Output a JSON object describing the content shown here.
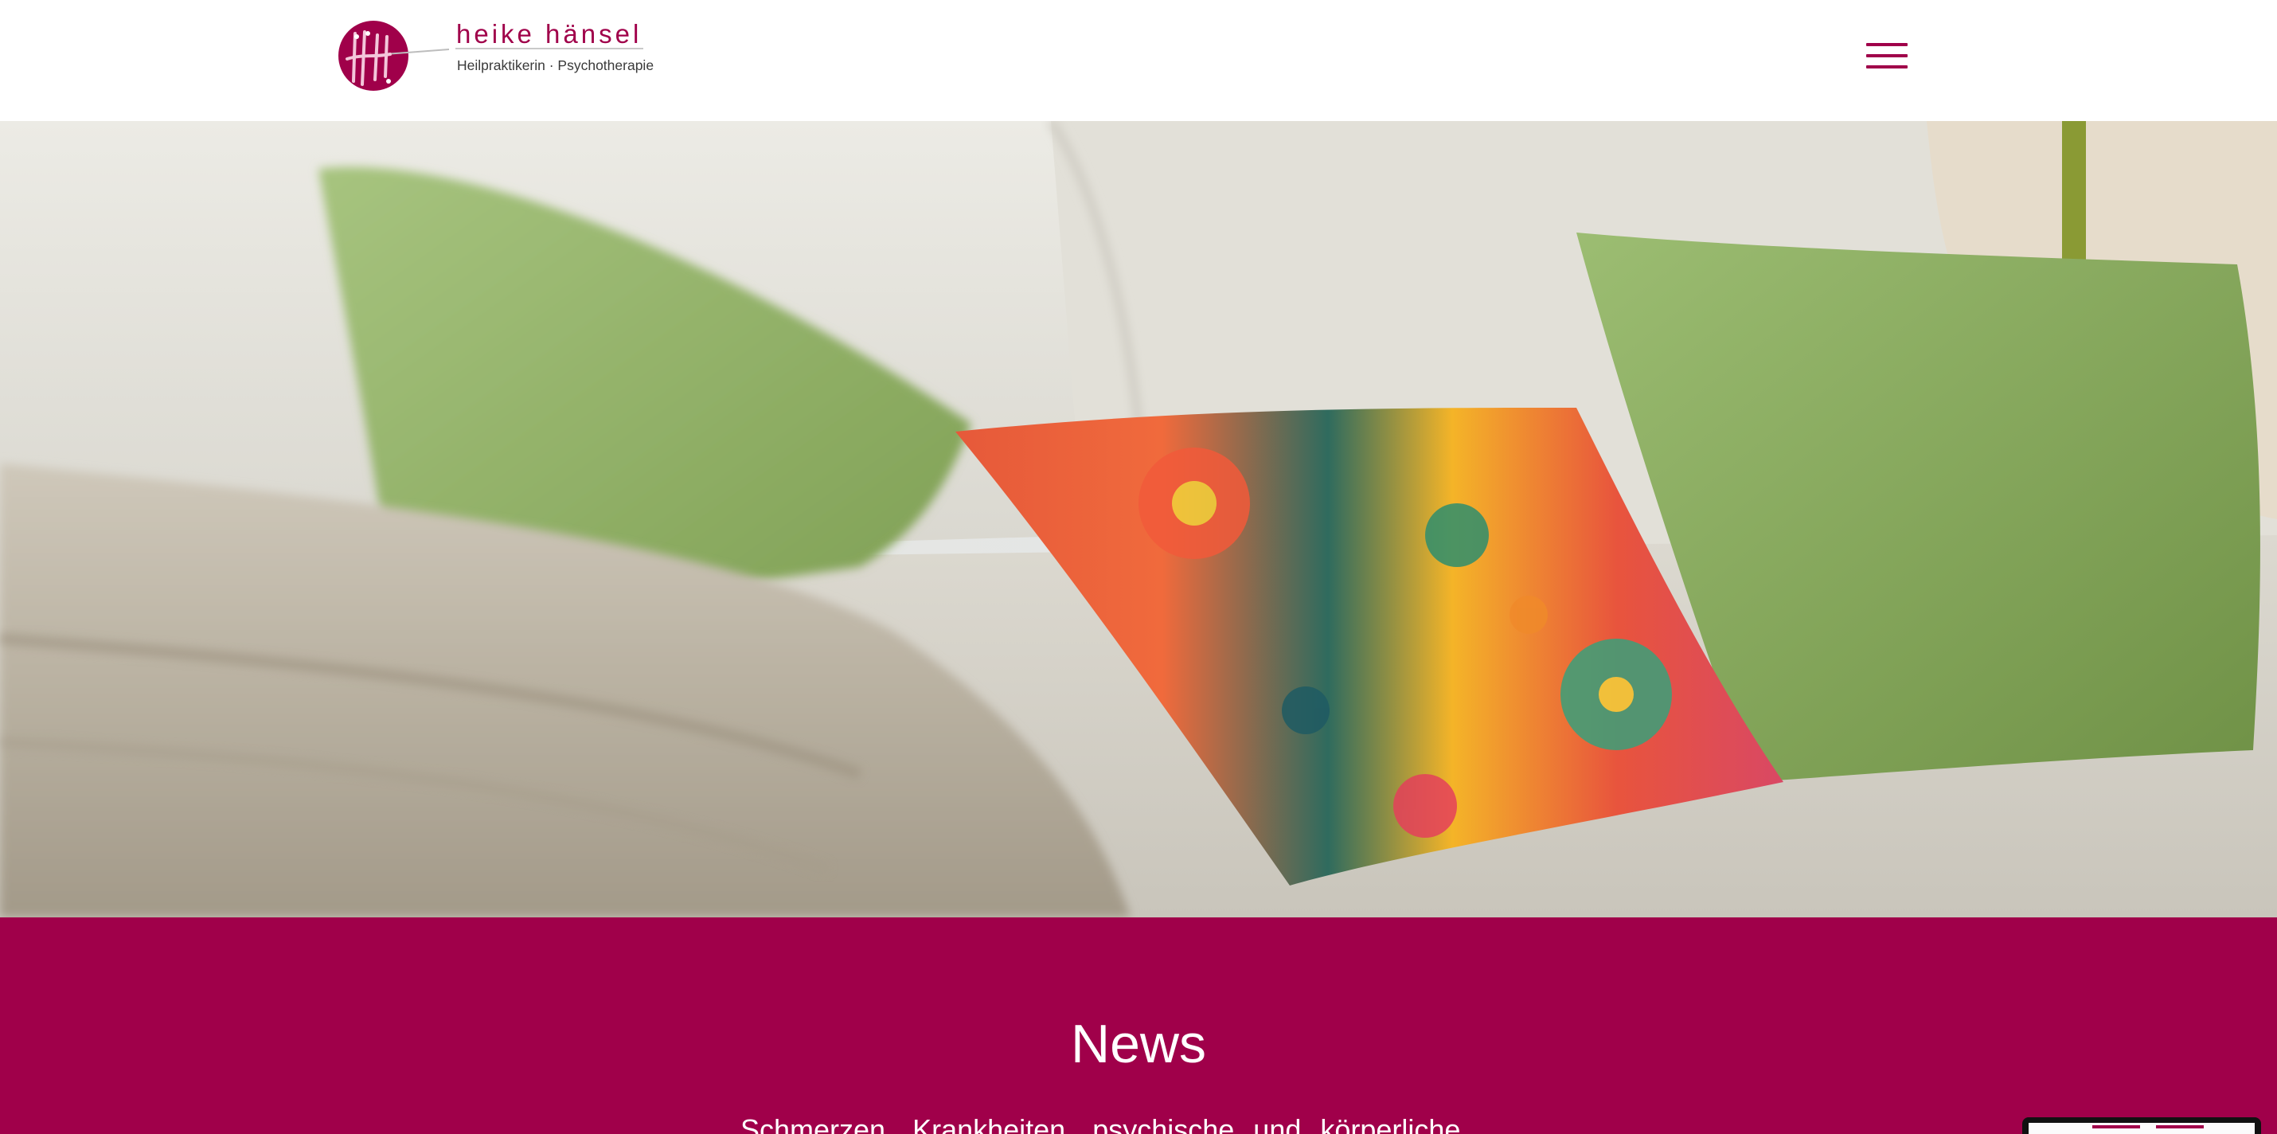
{
  "header": {
    "logo": {
      "monogram": "hh",
      "name": "heike hänsel",
      "tagline": "Heilpraktikerin · Psychotherapie"
    },
    "menu_icon": "hamburger-menu-icon"
  },
  "hero": {
    "image": "sofa-with-cushions-photo"
  },
  "news": {
    "title": "News",
    "text": "Schmerzen, Krankheiten, psychische und körperliche"
  },
  "colors": {
    "brand": "#a0004a",
    "header_bg": "#ffffff",
    "section_bg": "#a0004a",
    "section_text": "#ffffff"
  }
}
